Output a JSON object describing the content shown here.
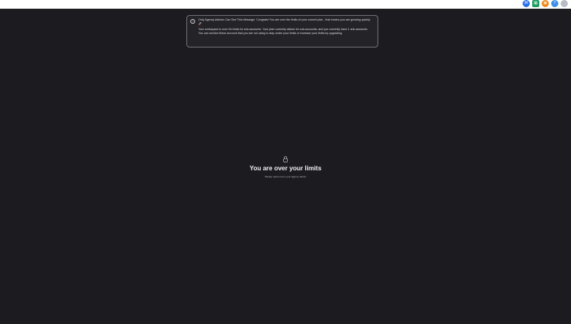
{
  "topbar": {
    "icons": [
      {
        "name": "link-icon",
        "color": "#2a6ee8",
        "glyph": "⌘"
      },
      {
        "name": "apps-icon",
        "color": "#1f9d62",
        "glyph": "▦"
      },
      {
        "name": "notifications-icon",
        "color": "#f08a1c",
        "glyph": "◉"
      },
      {
        "name": "help-icon",
        "color": "#3b8fe8",
        "glyph": "?"
      },
      {
        "name": "avatar",
        "color": "#b7bcc5",
        "glyph": ""
      }
    ]
  },
  "banner": {
    "line1": "Only Agency Admins Can See This Message. Congrats! You are over the limits of your current plan - that means you are growing quickly 🚀",
    "line2": "Your workspace is over it's limits for sub-accounts. Your plan currently allows for sub-accounts, and you currently have 1 sub-accounts. You can archive these account that you are not using to stay under your limits or increase your limits by upgrading."
  },
  "main": {
    "title": "You are over your limits",
    "subtitle": "Please reach out to your agency admin"
  }
}
